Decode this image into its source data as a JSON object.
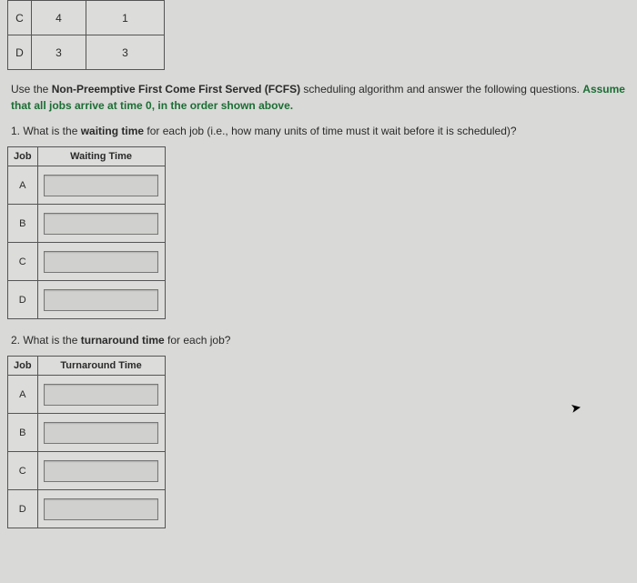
{
  "top_table": {
    "rows": [
      {
        "job": "C",
        "c2": "4",
        "c3": "1"
      },
      {
        "job": "D",
        "c2": "3",
        "c3": "3"
      }
    ]
  },
  "instruction": {
    "pre": "Use the ",
    "bold": "Non-Preemptive First Come First Served (FCFS)",
    "mid": " scheduling algorithm and answer the following questions. ",
    "assume": "Assume that all jobs arrive at time 0, in the order shown above."
  },
  "q1": {
    "num": "1. ",
    "pre": "What is the ",
    "bold": "waiting time",
    "post": " for each job (i.e., how many units of time must it wait before it is scheduled)?",
    "headers": {
      "job": "Job",
      "time": "Waiting Time"
    },
    "rows": [
      {
        "job": "A",
        "value": ""
      },
      {
        "job": "B",
        "value": ""
      },
      {
        "job": "C",
        "value": ""
      },
      {
        "job": "D",
        "value": ""
      }
    ]
  },
  "q2": {
    "num": "2. ",
    "pre": "What is the ",
    "bold": "turnaround time",
    "post": " for each job?",
    "headers": {
      "job": "Job",
      "time": "Turnaround Time"
    },
    "rows": [
      {
        "job": "A",
        "value": ""
      },
      {
        "job": "B",
        "value": ""
      },
      {
        "job": "C",
        "value": ""
      },
      {
        "job": "D",
        "value": ""
      }
    ]
  }
}
